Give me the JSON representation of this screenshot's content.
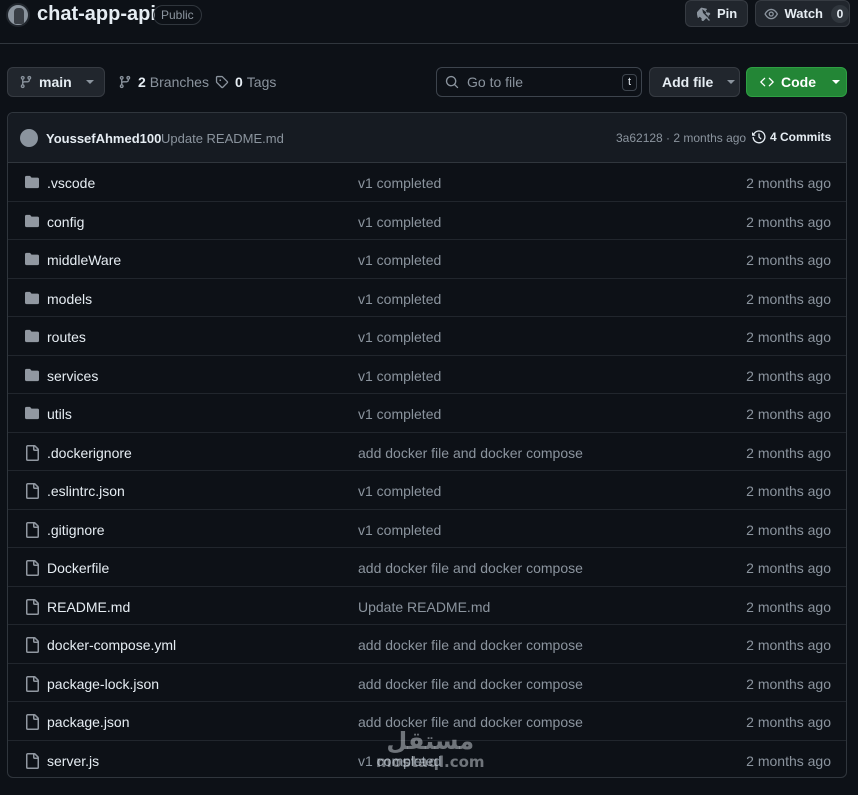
{
  "repo": {
    "name": "chat-app-api",
    "visibility": "Public"
  },
  "actions": {
    "pin_label": "Pin",
    "watch_label": "Watch",
    "watch_count": "0"
  },
  "toolbar": {
    "branch": "main",
    "branches_count": "2",
    "branches_label": "Branches",
    "tags_count": "0",
    "tags_label": "Tags",
    "search_placeholder": "Go to file",
    "search_shortcut": "t",
    "add_file_label": "Add file",
    "code_label": "Code"
  },
  "latest_commit": {
    "author": "YoussefAhmed100",
    "message": "Update README.md",
    "sha_and_time": "3a62128 · 2 months ago",
    "commits_label": "4 Commits"
  },
  "files": [
    {
      "name": ".vscode",
      "type": "dir",
      "message": "v1 completed",
      "age": "2 months ago"
    },
    {
      "name": "config",
      "type": "dir",
      "message": "v1 completed",
      "age": "2 months ago"
    },
    {
      "name": "middleWare",
      "type": "dir",
      "message": "v1 completed",
      "age": "2 months ago"
    },
    {
      "name": "models",
      "type": "dir",
      "message": "v1 completed",
      "age": "2 months ago"
    },
    {
      "name": "routes",
      "type": "dir",
      "message": "v1 completed",
      "age": "2 months ago"
    },
    {
      "name": "services",
      "type": "dir",
      "message": "v1 completed",
      "age": "2 months ago"
    },
    {
      "name": "utils",
      "type": "dir",
      "message": "v1 completed",
      "age": "2 months ago"
    },
    {
      "name": ".dockerignore",
      "type": "file",
      "message": "add docker file and docker compose",
      "age": "2 months ago"
    },
    {
      "name": ".eslintrc.json",
      "type": "file",
      "message": "v1 completed",
      "age": "2 months ago"
    },
    {
      "name": ".gitignore",
      "type": "file",
      "message": "v1 completed",
      "age": "2 months ago"
    },
    {
      "name": "Dockerfile",
      "type": "file",
      "message": "add docker file and docker compose",
      "age": "2 months ago"
    },
    {
      "name": "README.md",
      "type": "file",
      "message": "Update README.md",
      "age": "2 months ago"
    },
    {
      "name": "docker-compose.yml",
      "type": "file",
      "message": "add docker file and docker compose",
      "age": "2 months ago"
    },
    {
      "name": "package-lock.json",
      "type": "file",
      "message": "add docker file and docker compose",
      "age": "2 months ago"
    },
    {
      "name": "package.json",
      "type": "file",
      "message": "add docker file and docker compose",
      "age": "2 months ago"
    },
    {
      "name": "server.js",
      "type": "file",
      "message": "v1 completed",
      "age": "2 months ago"
    }
  ],
  "watermark": {
    "arabic": "مستقل",
    "latin": "mostaql.com"
  }
}
